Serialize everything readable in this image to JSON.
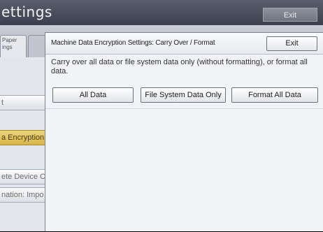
{
  "background": {
    "title": "ettings",
    "exit_label": "Exit",
    "tab_text": "Paper ings",
    "list_items": [
      {
        "label": "t"
      },
      {
        "label": "a Encryption"
      },
      {
        "label": "ete Device C"
      },
      {
        "label": "nation: Impo"
      }
    ],
    "selected_color": "#d9b64a"
  },
  "dialog": {
    "title": "Machine Data Encryption Settings: Carry Over / Format",
    "exit_label": "Exit",
    "message": "Carry over all data or file system data only (without formatting), or format all data.",
    "options": [
      {
        "label": "All Data"
      },
      {
        "label": "File System Data Only"
      },
      {
        "label": "Format All Data"
      }
    ]
  },
  "colors": {
    "header_bg": "#44485a",
    "content_bg": "#e3e6ec",
    "dialog_bg": "#f2f3f6"
  }
}
